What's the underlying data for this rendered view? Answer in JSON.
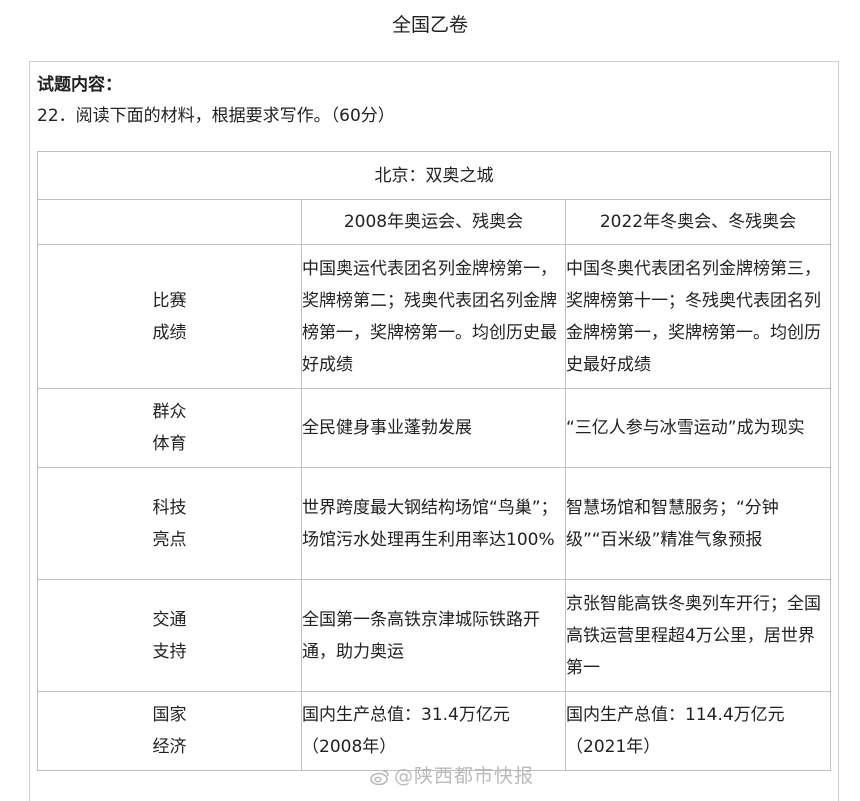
{
  "page_title": "全国乙卷",
  "section_label": "试题内容：",
  "question": "22．阅读下面的材料，根据要求写作。（60分）",
  "table": {
    "title": "北京：双奥之城",
    "col1": "2008年奥运会、残奥会",
    "col2": "2022年冬奥会、冬残奥会",
    "rows": [
      {
        "cat1": "比赛",
        "cat2": "成绩",
        "c1": "中国奥运代表团名列金牌榜第一，奖牌榜第二；残奥代表团名列金牌榜第一，奖牌榜第一。均创历史最好成绩",
        "c2": "中国冬奥代表团名列金牌榜第三，奖牌榜第十一；冬残奥代表团名列金牌榜第一，奖牌榜第一。均创历史最好成绩"
      },
      {
        "cat1": "群众",
        "cat2": "体育",
        "c1": "全民健身事业蓬勃发展",
        "c2": "“三亿人参与冰雪运动”成为现实"
      },
      {
        "cat1": "科技",
        "cat2": "亮点",
        "c1": "世界跨度最大钢结构场馆“鸟巢”；场馆污水处理再生利用率达100%",
        "c2": "智慧场馆和智慧服务；“分钟级”“百米级”精准气象预报"
      },
      {
        "cat1": "交通",
        "cat2": "支持",
        "c1": "全国第一条高铁京津城际铁路开通，助力奥运",
        "c2": "京张智能高铁冬奥列车开行；全国高铁运营里程超4万公里，居世界第一"
      },
      {
        "cat1": "国家",
        "cat2": "经济",
        "c1": "国内生产总值：31.4万亿元（2008年）",
        "c2": "国内生产总值：114.4万亿元（2021年）"
      }
    ]
  },
  "watermark": "@陕西都市快报"
}
